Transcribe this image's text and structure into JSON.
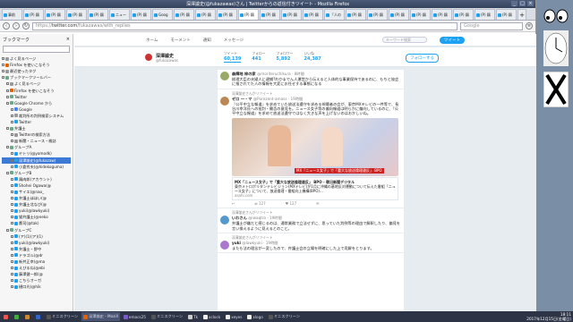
{
  "window": {
    "title": "深澤諭史(@fukazawas)さん | Twitterからの返信付きツイート - Mozilla Firefox",
    "controls": [
      "_",
      "□",
      "×"
    ]
  },
  "tabs": [
    {
      "label": "事前",
      "active": false
    },
    {
      "label": "(P) 鶏",
      "active": false
    },
    {
      "label": "(P) 鶏",
      "active": false
    },
    {
      "label": "(P) 鶏",
      "active": false
    },
    {
      "label": "(P) 鶏",
      "active": false
    },
    {
      "label": "ニュー",
      "active": false
    },
    {
      "label": "(P) 鶏",
      "active": false
    },
    {
      "label": "Goog",
      "active": false
    },
    {
      "label": "(P) 鶏",
      "active": false
    },
    {
      "label": "(P) 鶏",
      "active": false
    },
    {
      "label": "(P) 鶏",
      "active": false
    },
    {
      "label": "(P) 鶏",
      "active": true
    },
    {
      "label": "(P) 鶏",
      "active": false
    },
    {
      "label": "(P) 鶏",
      "active": false
    },
    {
      "label": "(P) 鶏",
      "active": false
    },
    {
      "label": "「人の",
      "active": false
    },
    {
      "label": "(P) 鶏",
      "active": false
    },
    {
      "label": "(P) 鶏",
      "active": false
    },
    {
      "label": "(P) 鶏",
      "active": false
    },
    {
      "label": "(P) 鶏",
      "active": false
    },
    {
      "label": "(P) 鶏",
      "active": false
    },
    {
      "label": "(P) 鶏",
      "active": false
    },
    {
      "label": "(P) 鶏",
      "active": false
    },
    {
      "label": "(P) 鶏",
      "active": false
    }
  ],
  "nav": {
    "url_prefix": "https://",
    "url_host": "twitter.com",
    "url_path": "/fukazawas/with_replies",
    "search_placeholder": "Google"
  },
  "sidebar": {
    "title": "ブックマーク",
    "search_placeholder": "",
    "items": [
      {
        "label": "よく見るページ",
        "indent": 0,
        "color": "#999",
        "sel": false
      },
      {
        "label": "Firefox を使いこなそう",
        "indent": 0,
        "color": "#e66000",
        "sel": false
      },
      {
        "label": "最近使ったタグ",
        "indent": 0,
        "color": "#999",
        "sel": false
      },
      {
        "label": "ブックマークツールバー",
        "indent": 0,
        "color": "#6a8",
        "sel": false
      },
      {
        "label": "よく見るページ",
        "indent": 1,
        "color": "#999",
        "sel": false
      },
      {
        "label": "Firefox を使いこなそう",
        "indent": 1,
        "color": "#e66000",
        "sel": false
      },
      {
        "label": "Twitter",
        "indent": 1,
        "color": "#6a8",
        "sel": false
      },
      {
        "label": "Google Chrome から",
        "indent": 1,
        "color": "#6a8",
        "sel": false
      },
      {
        "label": "Google",
        "indent": 2,
        "color": "#4285f4",
        "sel": false
      },
      {
        "label": "裁判所の判例検索システム",
        "indent": 2,
        "color": "#999",
        "sel": false
      },
      {
        "label": "Twitter",
        "indent": 2,
        "color": "#1da1f2",
        "sel": false
      },
      {
        "label": "弁護士",
        "indent": 1,
        "color": "#6a8",
        "sel": false
      },
      {
        "label": "Twitterの検索方法",
        "indent": 2,
        "color": "#999",
        "sel": false
      },
      {
        "label": "新聞・ニュース・雑誌",
        "indent": 2,
        "color": "#999",
        "sel": false
      },
      {
        "label": "グループA",
        "indent": 1,
        "color": "#6a8",
        "sel": false
      },
      {
        "label": "ヤトリ(@yomodk)",
        "indent": 2,
        "color": "#1da1f2",
        "sel": false
      },
      {
        "label": "深澤諭史(@fukazaw)",
        "indent": 2,
        "color": "#1da1f2",
        "sel": true
      },
      {
        "label": "小倉秀夫(@hidekoguma)",
        "indent": 2,
        "color": "#1da1f2",
        "sel": false
      },
      {
        "label": "グループB",
        "indent": 1,
        "color": "#6a8",
        "sel": false
      },
      {
        "label": "鶏肉郎(アカウント)",
        "indent": 2,
        "color": "#1da1f2",
        "sel": false
      },
      {
        "label": "Shohei Ogawa(@",
        "indent": 2,
        "color": "#1da1f2",
        "sel": false
      },
      {
        "label": "サイエ(@nao_",
        "indent": 2,
        "color": "#1da1f2",
        "sel": false
      },
      {
        "label": "弁護士ほほい(@",
        "indent": 2,
        "color": "#1da1f2",
        "sel": false
      },
      {
        "label": "弁護士北なび(@",
        "indent": 2,
        "color": "#1da1f2",
        "sel": false
      },
      {
        "label": "yuki(@lawkyuki)",
        "indent": 2,
        "color": "#1da1f2",
        "sel": false
      },
      {
        "label": "猫弁護士(@neko",
        "indent": 2,
        "color": "#1da1f2",
        "sel": false
      },
      {
        "label": "鷹司(@tak)",
        "indent": 2,
        "color": "#1da1f2",
        "sel": false
      },
      {
        "label": "グループC",
        "indent": 1,
        "color": "#6a8",
        "sel": false
      },
      {
        "label": "(ア)(1)(ア)(1)",
        "indent": 2,
        "color": "#1da1f2",
        "sel": false
      },
      {
        "label": "yuki(@lawkyuki)",
        "indent": 2,
        "color": "#1da1f2",
        "sel": false
      },
      {
        "label": "弁護士・野中",
        "indent": 2,
        "color": "#1da1f2",
        "sel": false
      },
      {
        "label": "ドラゴル(@dr",
        "indent": 2,
        "color": "#1da1f2",
        "sel": false
      },
      {
        "label": "新井正幸(@ma",
        "indent": 2,
        "color": "#1da1f2",
        "sel": false
      },
      {
        "label": "えびるね(@ebi",
        "indent": 2,
        "color": "#1da1f2",
        "sel": false
      },
      {
        "label": "藤澤健一郎(@",
        "indent": 2,
        "color": "#1da1f2",
        "sel": false
      },
      {
        "label": "こちらオーガ",
        "indent": 2,
        "color": "#1da1f2",
        "sel": false
      },
      {
        "label": "樋口光(@hik",
        "indent": 2,
        "color": "#1da1f2",
        "sel": false
      }
    ]
  },
  "twitter": {
    "nav": [
      "ホーム",
      "モーメント",
      "通知",
      "メッセージ"
    ],
    "search_placeholder": "キーワード検索",
    "tweet_button": "ツイート",
    "profile": {
      "name": "深澤諭史",
      "handle": "@fukazawas",
      "follow_label": "フォローする"
    },
    "stats": [
      {
        "label": "ツイート",
        "value": "60,139"
      },
      {
        "label": "フォロー",
        "value": "441"
      },
      {
        "label": "フォロワー",
        "value": "5,892"
      },
      {
        "label": "いいね",
        "value": "24,387"
      }
    ],
    "tweets": [
      {
        "rt": "",
        "name": "森輝地 梓の家",
        "handle": "@moriteruchikura · 8時間",
        "body": "総理大臣の夫婦人に逮捕?わかまでん人運営から伝えると人体的な事業保持であるのに、もちと協会に推されてた人の情報を大変にお任せする事態になる",
        "avatar": "#9a6",
        "media": false
      },
      {
        "rt": "深澤諭史さんがリツイート",
        "name": "ゼロ 一・マ",
        "handle": "@Purezent-amass · 19時間",
        "body": "『公平中立な報道』を求めていた放送法遵守を求める視聴者の会が、東京MXテレビの一件等で、長谷川幸洋氏への批判・賛否の意見を。ニュース女子等の偏向報道は明らかに偏向しているのに、『公平中立な報道』を求めて放送法遵守ではなく大きな声を上げないのはおかしいね。",
        "avatar": "#b85",
        "media": true,
        "media_caption": "MX「ニュース女子」で「重大な放送倫理違反」 BPO",
        "card_title": "MX「ニュース女子」で「重大な放送倫理違反」 BPO - 朝日新聞デジタル",
        "card_body": "東京メトロポリタンテレビジョン(MXテレビ)が1月に沖縄の基地反対運動について伝えた番組「ニュース女子」について、放送倫理・番組向上機構(BPO)...",
        "card_url": "asahi.com",
        "acts": [
          "",
          "127",
          "127",
          ""
        ]
      },
      {
        "rt": "深澤諭史さんがリツイート",
        "name": "いわさん",
        "handle": "@iwaqtro · 19時間",
        "body": "弁護士が嫌だと感じるのは、通常業務で立法せずに、思っていた判例等の理由で解釈したり、偏見を言い換えるように見えるとのこと。",
        "avatar": "#59c",
        "media": false
      },
      {
        "rt": "深澤諭史さんがリツイート",
        "name": "yuki",
        "handle": "@lawkyuki · 19時間",
        "body": "またも法の理念が一変したので、弁護士会の立場を明確にした上で見解をとります。",
        "avatar": "#a7c",
        "media": false
      }
    ]
  },
  "taskbar": {
    "items": [
      {
        "label": "",
        "color": "#e55",
        "active": false
      },
      {
        "label": "",
        "color": "#4a4",
        "active": false
      },
      {
        "label": "",
        "color": "#c83",
        "active": false
      },
      {
        "label": "",
        "color": "#36c",
        "active": false
      },
      {
        "label": "ミニスクリーン",
        "color": "#555",
        "active": false
      },
      {
        "label": "深澤諭史 - Mozill",
        "color": "#e66000",
        "active": true
      },
      {
        "label": "emacs25",
        "color": "#7a5cc7",
        "active": false
      },
      {
        "label": "ミニスクリーン",
        "color": "#555",
        "active": false
      },
      {
        "label": "Tk",
        "color": "#ccc",
        "active": false
      },
      {
        "label": "xclock",
        "color": "#eee",
        "active": false
      },
      {
        "label": "xeyes",
        "color": "#eee",
        "active": false
      },
      {
        "label": "xlogo",
        "color": "#eee",
        "active": false
      },
      {
        "label": "ミニスクリーン",
        "color": "#555",
        "active": false
      }
    ],
    "clock_time": "18:11",
    "clock_date": "2017年12月15日(金曜日)"
  },
  "colors": {
    "accent": "#1da1f2",
    "sidebar_selected": "#3d7ad6"
  }
}
